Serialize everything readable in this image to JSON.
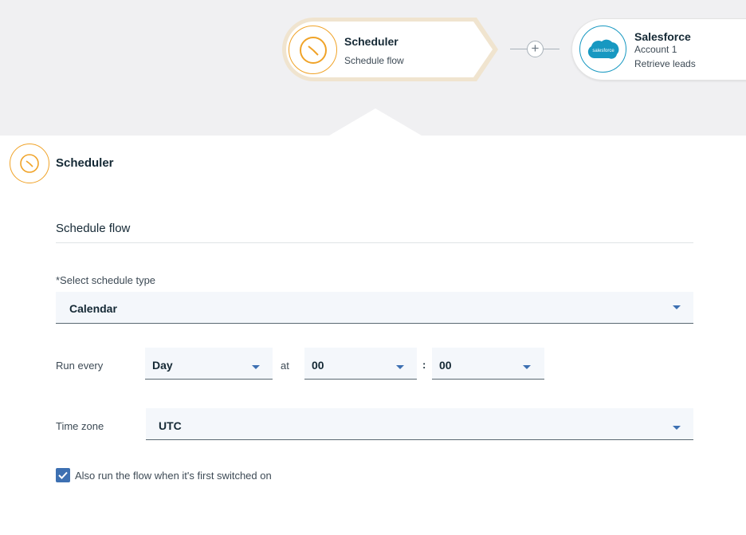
{
  "flow": {
    "scheduler_node": {
      "title": "Scheduler",
      "subtitle": "Schedule flow",
      "icon": "clock-icon"
    },
    "add_step": {
      "label": "+"
    },
    "salesforce_node": {
      "title": "Salesforce",
      "account": "Account 1",
      "action": "Retrieve leads",
      "icon": "salesforce-logo",
      "logo_text": "salesforce"
    }
  },
  "panel": {
    "title": "Scheduler",
    "flow_name": "Schedule flow",
    "schedule_type": {
      "label": "*Select schedule type",
      "value": "Calendar"
    },
    "run_every": {
      "label": "Run every",
      "unit": "Day",
      "at_label": "at",
      "hour": "00",
      "separator": ":",
      "minute": "00"
    },
    "time_zone": {
      "label": "Time zone",
      "value": "UTC"
    },
    "first_run": {
      "label": "Also run the flow when it's first switched on",
      "checked": true
    }
  },
  "colors": {
    "accent": "#3d70b2",
    "scheduler": "#f0a328",
    "salesforce": "#1798c1"
  }
}
